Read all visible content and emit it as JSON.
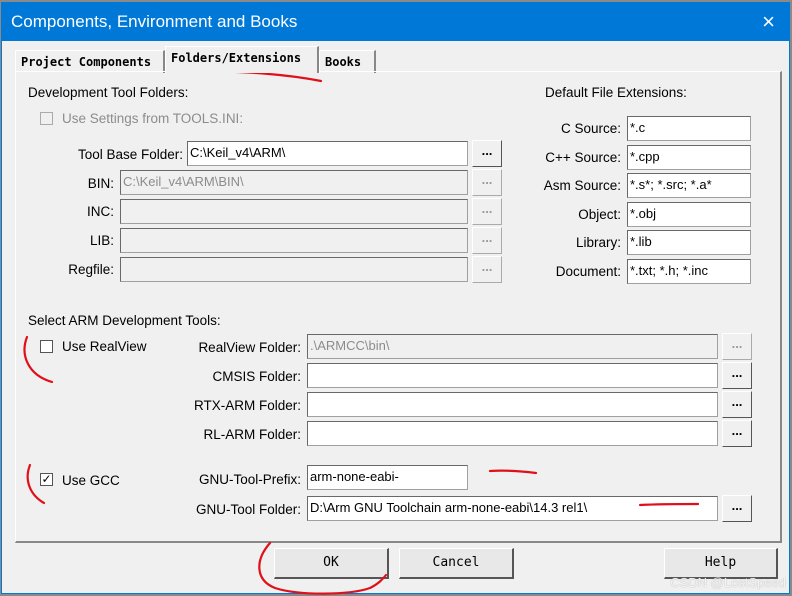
{
  "window": {
    "title": "Components, Environment and Books",
    "close_icon": "×"
  },
  "tabs": [
    {
      "label": "Project Components"
    },
    {
      "label": "Folders/Extensions",
      "active": true
    },
    {
      "label": "Books"
    }
  ],
  "dev_folders": {
    "heading": "Development Tool Folders:",
    "use_tools_ini": {
      "label": "Use Settings from TOOLS.INI:",
      "checked": false
    },
    "rows": [
      {
        "label": "Tool Base Folder:",
        "value": "C:\\Keil_v4\\ARM\\",
        "enabled": true
      },
      {
        "label": "BIN:",
        "value": "C:\\Keil_v4\\ARM\\BIN\\",
        "enabled": false
      },
      {
        "label": "INC:",
        "value": "",
        "enabled": false
      },
      {
        "label": "LIB:",
        "value": "",
        "enabled": false
      },
      {
        "label": "Regfile:",
        "value": "",
        "enabled": false
      }
    ],
    "browse_label": "..."
  },
  "extensions": {
    "heading": "Default File Extensions:",
    "rows": [
      {
        "label": "C Source:",
        "value": "*.c"
      },
      {
        "label": "C++ Source:",
        "value": "*.cpp"
      },
      {
        "label": "Asm Source:",
        "value": "*.s*; *.src; *.a*"
      },
      {
        "label": "Object:",
        "value": "*.obj"
      },
      {
        "label": "Library:",
        "value": "*.lib"
      },
      {
        "label": "Document:",
        "value": "*.txt; *.h; *.inc"
      }
    ]
  },
  "arm_tools": {
    "heading": "Select ARM Development Tools:",
    "use_realview": {
      "label": "Use RealView",
      "checked": false
    },
    "use_gcc": {
      "label": "Use GCC",
      "checked": true,
      "check_mark": "✓"
    },
    "rows": [
      {
        "label": "RealView Folder:",
        "value": ".\\ARMCC\\bin\\",
        "enabled": false
      },
      {
        "label": "CMSIS Folder:",
        "value": "",
        "enabled": true
      },
      {
        "label": "RTX-ARM Folder:",
        "value": "",
        "enabled": true
      },
      {
        "label": "RL-ARM Folder:",
        "value": "",
        "enabled": true
      }
    ],
    "gnu_prefix": {
      "label": "GNU-Tool-Prefix:",
      "value": "arm-none-eabi-"
    },
    "gnu_folder": {
      "label": "GNU-Tool Folder:",
      "value": "D:\\Arm GNU Toolchain arm-none-eabi\\14.3 rel1\\"
    }
  },
  "buttons": {
    "ok": "OK",
    "cancel": "Cancel",
    "help": "Help"
  },
  "watermark": "CSDN @LostSpeed",
  "colors": {
    "titlebar": "#0078d7",
    "annotation": "#e0101a"
  }
}
